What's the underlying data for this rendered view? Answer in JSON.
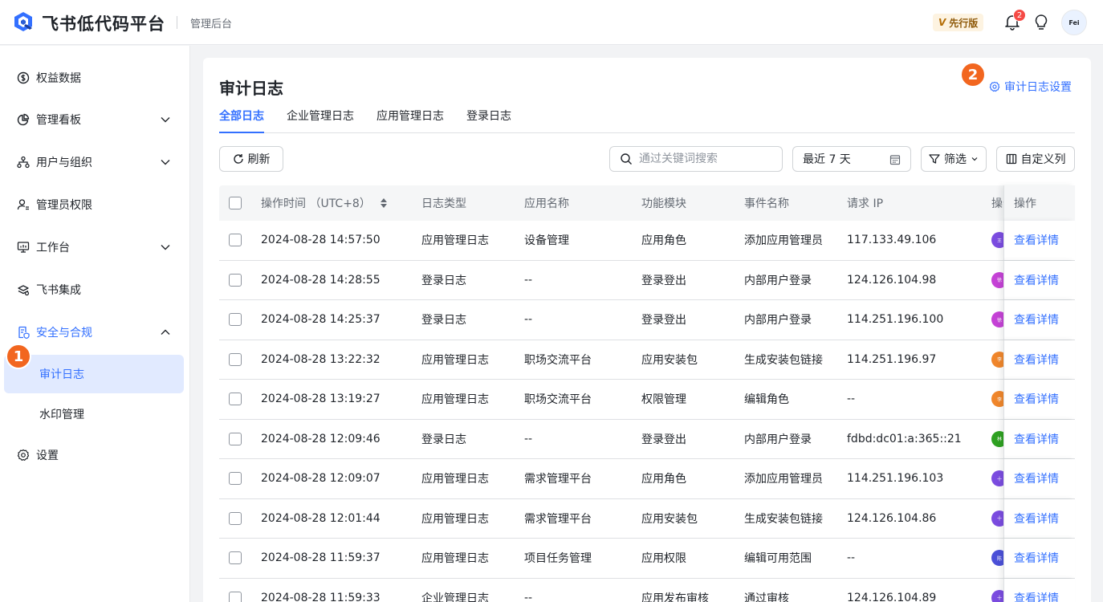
{
  "header": {
    "brand": "飞书低代码平台",
    "console": "管理后台",
    "edition_mark": "V",
    "edition": "先行版",
    "notifications": "2",
    "avatar_text": "Fei",
    "brand_color": "#3370ff"
  },
  "sidebar": {
    "items": [
      {
        "label": "权益数据",
        "icon": "dollar-circle-icon"
      },
      {
        "label": "管理看板",
        "icon": "pie-chart-icon"
      },
      {
        "label": "用户与组织",
        "icon": "org-tree-icon"
      },
      {
        "label": "管理员权限",
        "icon": "admin-user-icon"
      },
      {
        "label": "工作台",
        "icon": "monitor-icon"
      },
      {
        "label": "飞书集成",
        "icon": "integration-icon"
      },
      {
        "label": "安全与合规",
        "icon": "shield-doc-icon"
      },
      {
        "label": "设置",
        "icon": "gear-icon"
      }
    ],
    "sub_items": [
      {
        "label": "审计日志"
      },
      {
        "label": "水印管理"
      }
    ],
    "marker": "1"
  },
  "main": {
    "title": "审计日志",
    "settings_link": "审计日志设置",
    "marker": "2",
    "tabs": [
      {
        "label": "全部日志"
      },
      {
        "label": "企业管理日志"
      },
      {
        "label": "应用管理日志"
      },
      {
        "label": "登录日志"
      }
    ],
    "refresh_label": "刷新",
    "search_placeholder": "通过关键词搜索",
    "date_range": "最近 7 天",
    "filter_label": "筛选",
    "columns_label": "自定义列"
  },
  "table": {
    "columns": [
      "操作时间 （UTC+8）",
      "日志类型",
      "应用名称",
      "功能模块",
      "事件名称",
      "请求 IP",
      "操作",
      "操作"
    ],
    "action_label": "查看详情",
    "rows": [
      {
        "time": "2024-08-28 14:57:50",
        "type": "应用管理日志",
        "app": "设备管理",
        "module": "应用角色",
        "event": "添加应用管理员",
        "ip": "117.133.49.106",
        "op_color": "#7b4ce0",
        "op_text": "王"
      },
      {
        "time": "2024-08-28 14:28:55",
        "type": "登录日志",
        "app": "--",
        "module": "登录登出",
        "event": "内部用户登录",
        "ip": "124.126.104.98",
        "op_color": "#c542d6",
        "op_text": "徐"
      },
      {
        "time": "2024-08-28 14:25:37",
        "type": "登录日志",
        "app": "--",
        "module": "登录登出",
        "event": "内部用户登录",
        "ip": "114.251.196.100",
        "op_color": "#c542d6",
        "op_text": "徐"
      },
      {
        "time": "2024-08-28 13:22:32",
        "type": "应用管理日志",
        "app": "职场交流平台",
        "module": "应用安装包",
        "event": "生成安装包链接",
        "ip": "114.251.196.97",
        "op_color": "#f0862b",
        "op_text": "李"
      },
      {
        "time": "2024-08-28 13:19:27",
        "type": "应用管理日志",
        "app": "职场交流平台",
        "module": "权限管理",
        "event": "编辑角色",
        "ip": "--",
        "op_color": "#f0862b",
        "op_text": "李"
      },
      {
        "time": "2024-08-28 12:09:46",
        "type": "登录日志",
        "app": "--",
        "module": "登录登出",
        "event": "内部用户登录",
        "ip": "fdbd:dc01:a:365::21",
        "op_color": "#2ea121",
        "op_text": "林"
      },
      {
        "time": "2024-08-28 12:09:07",
        "type": "应用管理日志",
        "app": "需求管理平台",
        "module": "应用角色",
        "event": "添加应用管理员",
        "ip": "114.251.196.103",
        "op_color": "#7b4ce0",
        "op_text": "十"
      },
      {
        "time": "2024-08-28 12:01:44",
        "type": "应用管理日志",
        "app": "需求管理平台",
        "module": "应用安装包",
        "event": "生成安装包链接",
        "ip": "124.126.104.86",
        "op_color": "#7b4ce0",
        "op_text": "十"
      },
      {
        "time": "2024-08-28 11:59:37",
        "type": "应用管理日志",
        "app": "项目任务管理",
        "module": "应用权限",
        "event": "编辑可用范围",
        "ip": "--",
        "op_color": "#4b50d8",
        "op_text": "陈"
      },
      {
        "time": "2024-08-28 11:59:33",
        "type": "企业管理日志",
        "app": "--",
        "module": "应用发布审核",
        "event": "通过审核",
        "ip": "124.126.104.89",
        "op_color": "#7b4ce0",
        "op_text": "十"
      }
    ]
  }
}
